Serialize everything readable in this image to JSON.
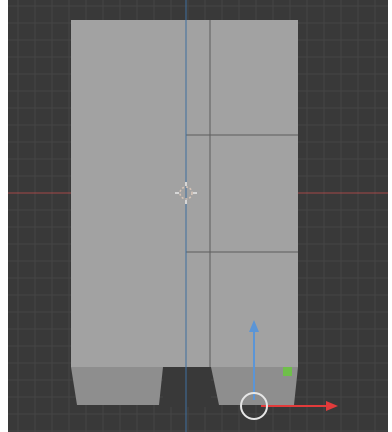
{
  "viewport": {
    "background_color": "#393939",
    "grid_color": "#454545",
    "x_axis_color": "#a34848",
    "y_axis_color": "#3f6f9e",
    "mesh_fill": "#a2a2a2",
    "mesh_shade": "#8e8e8e",
    "edge_color": "#5c5c5c"
  },
  "gizmo": {
    "z_arrow_color": "#5b95d6",
    "x_arrow_color": "#e23b3b",
    "handle_color": "#6fbf4a",
    "ring_color": "#e6e6e6",
    "icon": "move-gizmo-icon"
  },
  "origin": {
    "icon": "object-origin-crosshair-icon"
  }
}
